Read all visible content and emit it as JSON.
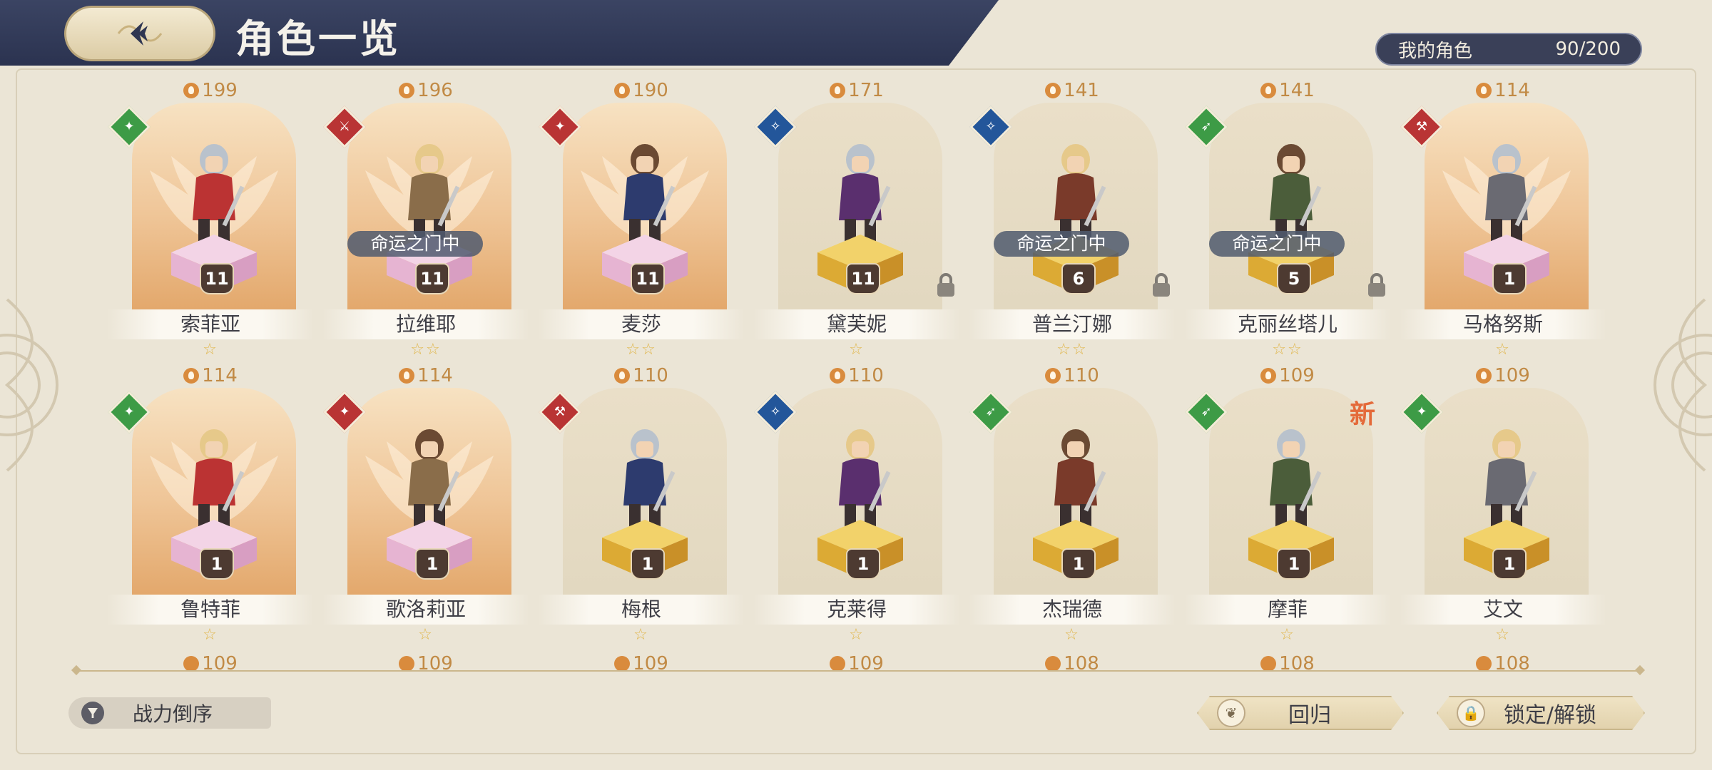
{
  "header": {
    "title": "角色一览"
  },
  "owned": {
    "label": "我的角色",
    "count": "90/200"
  },
  "characters": [
    {
      "name": "索菲亚",
      "power": "199",
      "level": "11",
      "stars": "☆",
      "element": "green",
      "glyph": "✦",
      "gold": true,
      "fate": "",
      "lock": false,
      "new": false
    },
    {
      "name": "拉维耶",
      "power": "196",
      "level": "11",
      "stars": "☆☆",
      "element": "red",
      "glyph": "⚔",
      "gold": true,
      "fate": "命运之门中",
      "lock": false,
      "new": false
    },
    {
      "name": "麦莎",
      "power": "190",
      "level": "11",
      "stars": "☆☆",
      "element": "red",
      "glyph": "✦",
      "gold": true,
      "fate": "",
      "lock": false,
      "new": false
    },
    {
      "name": "黛芙妮",
      "power": "171",
      "level": "11",
      "stars": "☆",
      "element": "blue",
      "glyph": "✧",
      "gold": false,
      "fate": "",
      "lock": true,
      "new": false
    },
    {
      "name": "普兰汀娜",
      "power": "141",
      "level": "6",
      "stars": "☆☆",
      "element": "blue",
      "glyph": "✧",
      "gold": false,
      "fate": "命运之门中",
      "lock": true,
      "new": false
    },
    {
      "name": "克丽丝塔儿",
      "power": "141",
      "level": "5",
      "stars": "☆☆",
      "element": "green",
      "glyph": "➶",
      "gold": false,
      "fate": "命运之门中",
      "lock": true,
      "new": false
    },
    {
      "name": "马格努斯",
      "power": "114",
      "level": "1",
      "stars": "☆",
      "element": "red",
      "glyph": "⚒",
      "gold": true,
      "fate": "",
      "lock": false,
      "new": false
    },
    {
      "name": "鲁特菲",
      "power": "114",
      "level": "1",
      "stars": "☆",
      "element": "green",
      "glyph": "✦",
      "gold": true,
      "fate": "",
      "lock": false,
      "new": false
    },
    {
      "name": "歌洛莉亚",
      "power": "114",
      "level": "1",
      "stars": "☆",
      "element": "red",
      "glyph": "✦",
      "gold": true,
      "fate": "",
      "lock": false,
      "new": false
    },
    {
      "name": "梅根",
      "power": "110",
      "level": "1",
      "stars": "☆",
      "element": "red",
      "glyph": "⚒",
      "gold": false,
      "fate": "",
      "lock": false,
      "new": false
    },
    {
      "name": "克莱得",
      "power": "110",
      "level": "1",
      "stars": "☆",
      "element": "blue",
      "glyph": "✧",
      "gold": false,
      "fate": "",
      "lock": false,
      "new": false
    },
    {
      "name": "杰瑞德",
      "power": "110",
      "level": "1",
      "stars": "☆",
      "element": "green",
      "glyph": "➶",
      "gold": false,
      "fate": "",
      "lock": false,
      "new": false
    },
    {
      "name": "摩菲",
      "power": "109",
      "level": "1",
      "stars": "☆",
      "element": "green",
      "glyph": "➶",
      "gold": false,
      "fate": "",
      "lock": false,
      "new": true
    },
    {
      "name": "艾文",
      "power": "109",
      "level": "1",
      "stars": "☆",
      "element": "green",
      "glyph": "✦",
      "gold": false,
      "fate": "",
      "lock": false,
      "new": false
    }
  ],
  "new_label": "新",
  "next_row_powers": [
    "109",
    "109",
    "109",
    "109",
    "108",
    "108",
    "108"
  ],
  "footer": {
    "sort_label": "战力倒序",
    "return_label": "回归",
    "lock_label": "锁定/解锁"
  }
}
